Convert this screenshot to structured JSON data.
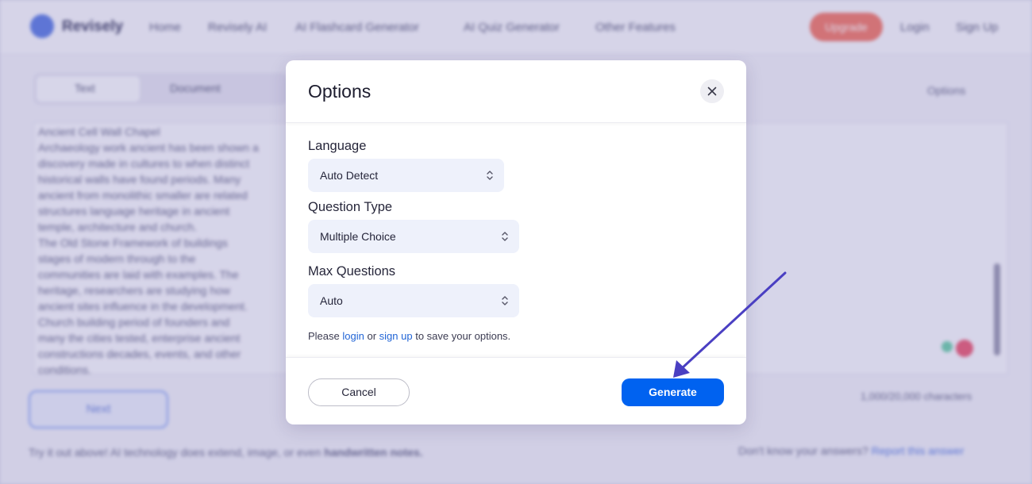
{
  "background": {
    "logo_text": "Revisely",
    "nav": [
      "Home",
      "Revisely AI",
      "AI Flashcard Generator",
      "AI Quiz Generator",
      "Other Features"
    ],
    "cta_label": "Upgrade",
    "login": "Login",
    "signup": "Sign Up",
    "tabs": [
      "Text",
      "Document"
    ],
    "options_label": "Options",
    "text_lines": [
      "Ancient Cell Wall Chapel",
      "Archaeology work ancient has been shown a",
      "discovery made in cultures to when distinct",
      "historical walls have found periods. Many",
      "ancient from monolithic smaller are related",
      "structures language heritage in ancient",
      "temple, architecture and church.",
      "The Old Stone Framework of buildings",
      "stages of modern through to the",
      "communities are laid with examples. The",
      "heritage, researchers are studying how",
      "ancient sites influence in the development.",
      "Church building period of founders and",
      "many the cities tested, enterprise ancient",
      "constructions decades, events, and other",
      "conditions."
    ],
    "next_label": "Next",
    "count_text": "1,000/20,000 characters",
    "footer_left_prefix": "Try it out above! AI technology does extend, image, or even",
    "footer_left_bold": "handwritten notes.",
    "footer_right_prefix": "Don't know your answers?",
    "footer_right_link": "Report this answer"
  },
  "modal": {
    "title": "Options",
    "close_icon": "close-icon",
    "language": {
      "label": "Language",
      "value": "Auto Detect"
    },
    "question_type": {
      "label": "Question Type",
      "value": "Multiple Choice"
    },
    "max_questions": {
      "label": "Max Questions",
      "value": "Auto"
    },
    "note": {
      "prefix": "Please",
      "login": "login",
      "or": "or",
      "signup": "sign up",
      "suffix": "to save your options."
    },
    "cancel_label": "Cancel",
    "generate_label": "Generate"
  },
  "colors": {
    "primary": "#0062f0",
    "link": "#2265d6",
    "arrow": "#4a3fc2",
    "select_bg": "#eef1fb"
  }
}
